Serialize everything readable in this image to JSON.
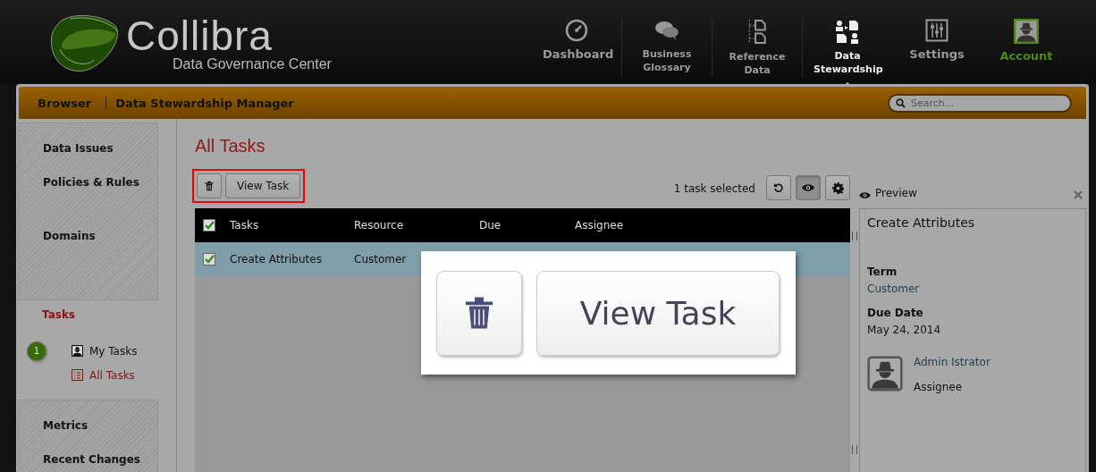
{
  "header": {
    "logo": {
      "name": "Collibra",
      "subtitle": "Data Governance Center"
    },
    "nav": [
      {
        "label": "Dashboard",
        "kind": "dashboard",
        "selected": false
      },
      {
        "label": "Business Glossary",
        "kind": "glossary",
        "selected": false
      },
      {
        "label": "Reference Data",
        "kind": "reference",
        "selected": false
      },
      {
        "label": "Data Stewardship",
        "kind": "stewardship",
        "selected": true
      },
      {
        "label": "Settings",
        "kind": "settings",
        "selected": false
      },
      {
        "label": "Account",
        "kind": "account",
        "selected": false
      }
    ]
  },
  "toolbar": {
    "breadcrumb": [
      "Browser",
      "Data Stewardship Manager"
    ],
    "search": {
      "placeholder": "Search..."
    }
  },
  "sidebar": {
    "sections": [
      {
        "kind": "group",
        "items": [
          {
            "label": "Data Issues"
          },
          {
            "label": "Policies & Rules"
          },
          {
            "label": "Domains"
          }
        ]
      },
      {
        "kind": "active",
        "title": "Tasks",
        "items": [
          {
            "label": "My Tasks",
            "badge": "1",
            "kind": "mine",
            "selected": false
          },
          {
            "label": "All Tasks",
            "kind": "all",
            "selected": true
          }
        ]
      },
      {
        "kind": "group",
        "items": [
          {
            "label": "Metrics"
          },
          {
            "label": "Recent Changes"
          }
        ]
      }
    ]
  },
  "main": {
    "title": "All Tasks",
    "actions": {
      "view_label": "View Task"
    },
    "selection_text": "1 task selected",
    "tools": [
      {
        "kind": "refresh",
        "selected": false
      },
      {
        "kind": "preview",
        "selected": true
      },
      {
        "kind": "settings",
        "selected": false
      }
    ],
    "table": {
      "all_checked": true,
      "columns": [
        "Tasks",
        "Resource",
        "Due",
        "Assignee"
      ],
      "rows": [
        {
          "cells": [
            "Create Attributes",
            "Customer"
          ],
          "checked": true,
          "selected": true
        }
      ]
    }
  },
  "preview": {
    "label": "Preview",
    "title": "Create Attributes",
    "fields": [
      {
        "label": "Term",
        "value": "Customer",
        "kind": "link"
      },
      {
        "label": "Due Date",
        "value": "May 24, 2014",
        "kind": "text"
      }
    ],
    "assignee": {
      "name": "Admin Istrator",
      "role": "Assignee"
    }
  },
  "callout": {
    "view_label": "View Task"
  }
}
